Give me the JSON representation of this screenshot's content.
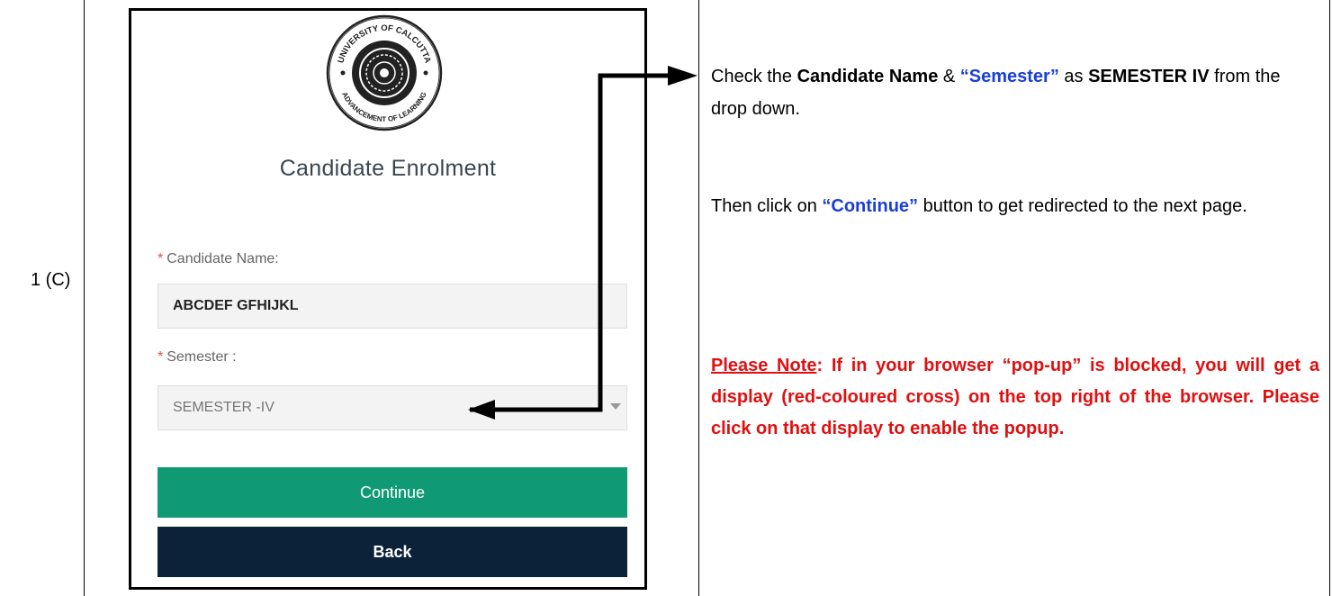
{
  "step": {
    "label": "1 (C)"
  },
  "form": {
    "title": "Candidate Enrolment",
    "required_mark": "*",
    "candidate_name": {
      "label": "Candidate Name:",
      "value": "ABCDEF GFHIJKL"
    },
    "semester": {
      "label": "Semester :",
      "selected": "SEMESTER -IV"
    },
    "continue_label": "Continue",
    "back_label": "Back",
    "logo": {
      "name": "university-of-calcutta-seal-icon",
      "text_top": "UNIVERSITY OF CALCUTTA",
      "text_bottom": "ADVANCEMENT OF LEARNING"
    }
  },
  "instructions": {
    "p1": {
      "t1": "Check the ",
      "b1": "Candidate Name",
      "t2": " & ",
      "q1": "“Semester”",
      "t3": " as ",
      "b2": "SEMESTER IV",
      "t4": " from the drop down."
    },
    "p2": {
      "t1": "Then click on ",
      "q1": "“Continue”",
      "t2": " button to get redirected to the next page."
    },
    "note": {
      "head": "Please Note",
      "body": ": If in your browser “pop-up” is blocked, you will get a display (red-coloured cross) on the top right of the browser. Please click on that display to enable the popup."
    }
  },
  "colors": {
    "continue_button": "#0f9a73",
    "back_button": "#0c2238",
    "note_text": "#e01010",
    "highlight_blue": "#1a3fd6"
  }
}
